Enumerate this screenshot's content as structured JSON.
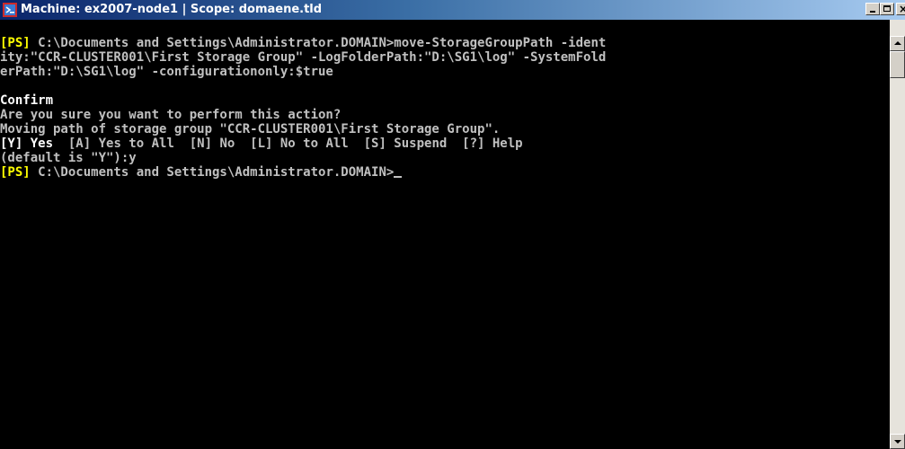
{
  "window": {
    "title": "Machine: ex2007-node1 | Scope: domaene.tld",
    "icon": "powershell-icon",
    "controls": {
      "minimize": "minimize-icon",
      "maximize": "maximize-icon",
      "close": "close-icon"
    }
  },
  "console": {
    "prompt_tag": "[PS]",
    "lines": [
      {
        "prefix": "[PS]",
        "text": " C:\\Documents and Settings\\Administrator.DOMAIN>move-StorageGroupPath -ident"
      },
      {
        "prefix": "",
        "text": "ity:\"CCR-CLUSTER001\\First Storage Group\" -LogFolderPath:\"D:\\SG1\\log\" -SystemFold"
      },
      {
        "prefix": "",
        "text": "erPath:\"D:\\SG1\\log\" -configurationonly:$true"
      },
      {
        "prefix": "",
        "text": ""
      },
      {
        "prefix": "",
        "text": "Confirm"
      },
      {
        "prefix": "",
        "text": "Are you sure you want to perform this action?"
      },
      {
        "prefix": "",
        "text": "Moving path of storage group \"CCR-CLUSTER001\\First Storage Group\"."
      },
      {
        "prefix": "",
        "default_choice": "[Y] Yes",
        "text": "  [A] Yes to All  [N] No  [L] No to All  [S] Suspend  [?] Help"
      },
      {
        "prefix": "",
        "text": "(default is \"Y\"):y"
      },
      {
        "prefix": "[PS]",
        "text": " C:\\Documents and Settings\\Administrator.DOMAIN>",
        "cursor": true
      }
    ]
  },
  "colors": {
    "background": "#000000",
    "text": "#c0c0c0",
    "prompt": "#ffff00",
    "highlight": "#ffffff"
  }
}
